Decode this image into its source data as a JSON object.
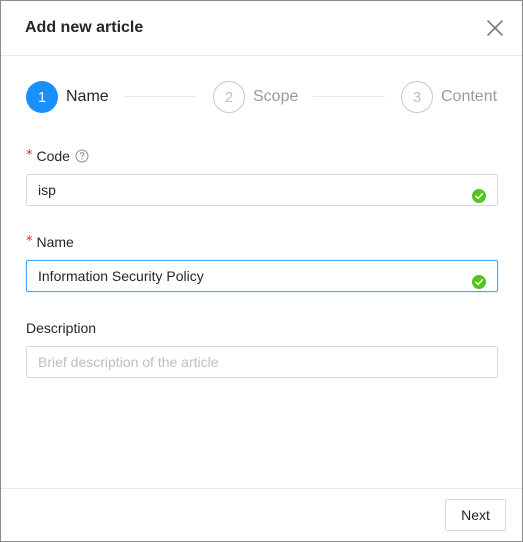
{
  "dialog": {
    "title": "Add new article"
  },
  "steps": [
    {
      "number": "1",
      "label": "Name",
      "state": "active"
    },
    {
      "number": "2",
      "label": "Scope",
      "state": "inactive"
    },
    {
      "number": "3",
      "label": "Content",
      "state": "inactive"
    }
  ],
  "form": {
    "code": {
      "required_mark": "*",
      "label": "Code",
      "value": "isp",
      "valid": true
    },
    "name": {
      "required_mark": "*",
      "label": "Name",
      "value": "Information Security Policy",
      "valid": true
    },
    "description": {
      "label": "Description",
      "value": "",
      "placeholder": "Brief description of the article"
    }
  },
  "footer": {
    "next_label": "Next"
  },
  "colors": {
    "primary": "#1890ff",
    "success": "#52c41a",
    "required": "#f5222d"
  }
}
